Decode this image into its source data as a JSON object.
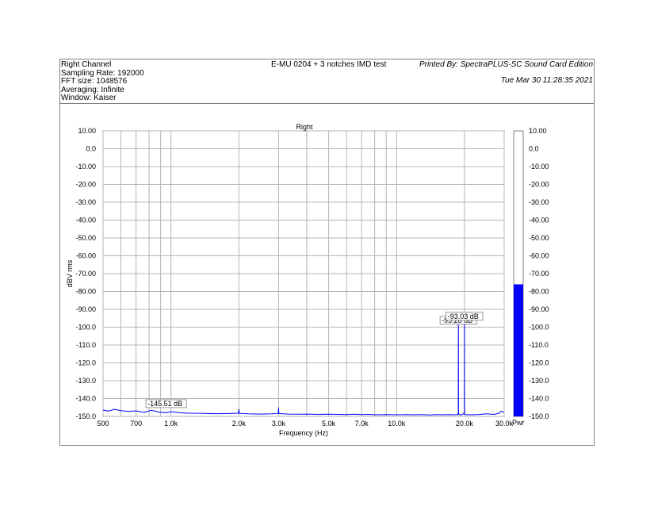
{
  "header": {
    "info_lines": [
      "Right Channel",
      "Sampling Rate: 192000",
      "FFT size: 1048576",
      "Averaging: Infinite",
      "Window: Kaiser"
    ],
    "title": "E-MU 0204 + 3 notches IMD test",
    "printed_by": "Printed By: SpectraPLUS-SC Sound Card Edition",
    "date": "Tue Mar 30 11:28:35 2021"
  },
  "chart_data": {
    "type": "line",
    "title": "Right",
    "xlabel": "Frequency (Hz)",
    "ylabel": "dBV rms",
    "x_scale": "log",
    "xlim": [
      500,
      30000
    ],
    "ylim": [
      -150,
      10
    ],
    "grid": true,
    "x_gridlines": [
      500,
      600,
      700,
      800,
      900,
      1000,
      2000,
      3000,
      4000,
      5000,
      6000,
      7000,
      8000,
      9000,
      10000,
      20000,
      30000
    ],
    "x_ticks": [
      {
        "value": 500,
        "label": "500"
      },
      {
        "value": 700,
        "label": "700"
      },
      {
        "value": 1000,
        "label": "1.0k"
      },
      {
        "value": 2000,
        "label": "2.0k"
      },
      {
        "value": 3000,
        "label": "3.0k"
      },
      {
        "value": 5000,
        "label": "5.0k"
      },
      {
        "value": 7000,
        "label": "7.0k"
      },
      {
        "value": 10000,
        "label": "10.0k"
      },
      {
        "value": 20000,
        "label": "20.0k"
      },
      {
        "value": 30000,
        "label": "30.0k"
      }
    ],
    "y_ticks": [
      {
        "value": 10,
        "label": "10.00"
      },
      {
        "value": 0,
        "label": "0.0"
      },
      {
        "value": -10,
        "label": "-10.00"
      },
      {
        "value": -20,
        "label": "-20.00"
      },
      {
        "value": -30,
        "label": "-30.00"
      },
      {
        "value": -40,
        "label": "-40.00"
      },
      {
        "value": -50,
        "label": "-50.00"
      },
      {
        "value": -60,
        "label": "-60.00"
      },
      {
        "value": -70,
        "label": "-70.00"
      },
      {
        "value": -80,
        "label": "-80.00"
      },
      {
        "value": -90,
        "label": "-90.00"
      },
      {
        "value": -100,
        "label": "-100.0"
      },
      {
        "value": -110,
        "label": "-110.0"
      },
      {
        "value": -120,
        "label": "-120.0"
      },
      {
        "value": -130,
        "label": "-130.0"
      },
      {
        "value": -140,
        "label": "-140.0"
      },
      {
        "value": -150,
        "label": "-150.0"
      }
    ],
    "series": [
      {
        "color": "#0000ff",
        "x": [
          500,
          530,
          560,
          600,
          650,
          700,
          760,
          820,
          880,
          950,
          1000,
          1100,
          1200,
          1400,
          1600,
          1800,
          1990,
          2000,
          2010,
          2200,
          2500,
          2800,
          2990,
          3000,
          3010,
          3300,
          3700,
          4000,
          4500,
          5000,
          5500,
          6000,
          6500,
          7000,
          7500,
          8000,
          9000,
          10000,
          11000,
          12000,
          13000,
          14000,
          15000,
          16000,
          17000,
          18000,
          18700,
          18780,
          18800,
          18820,
          18900,
          19500,
          19980,
          20000,
          20020,
          20100,
          21000,
          23000,
          25000,
          27000,
          28500,
          29000,
          30000
        ],
        "y": [
          -146.5,
          -147.0,
          -146.0,
          -146.8,
          -147.2,
          -146.9,
          -147.8,
          -146.6,
          -147.5,
          -148.0,
          -147.4,
          -148.0,
          -148.2,
          -148.3,
          -148.5,
          -148.4,
          -148.2,
          -146.0,
          -148.3,
          -148.6,
          -148.7,
          -148.6,
          -148.3,
          -145.0,
          -148.4,
          -148.7,
          -148.8,
          -148.7,
          -148.9,
          -148.8,
          -148.9,
          -149.0,
          -148.8,
          -149.0,
          -148.9,
          -149.1,
          -149.0,
          -149.1,
          -149.0,
          -149.1,
          -149.0,
          -149.2,
          -149.0,
          -149.1,
          -149.0,
          -149.1,
          -149.0,
          -148.0,
          -95.3,
          -148.2,
          -149.0,
          -149.1,
          -148.0,
          -93.0,
          -148.1,
          -149.0,
          -149.1,
          -149.0,
          -148.6,
          -148.9,
          -148.2,
          -147.2,
          -147.6
        ]
      }
    ],
    "annotations": [
      {
        "x": 800,
        "y": -145.51,
        "text": "-145.51 dB"
      },
      {
        "x": 18800,
        "y": -95.28,
        "text": "-95.28 dB"
      },
      {
        "x": 20000,
        "y": -93.0,
        "text": "-93.03 dB"
      }
    ],
    "power_bar": {
      "label": "Pwr",
      "value": -76,
      "color": "#0000ff"
    }
  }
}
